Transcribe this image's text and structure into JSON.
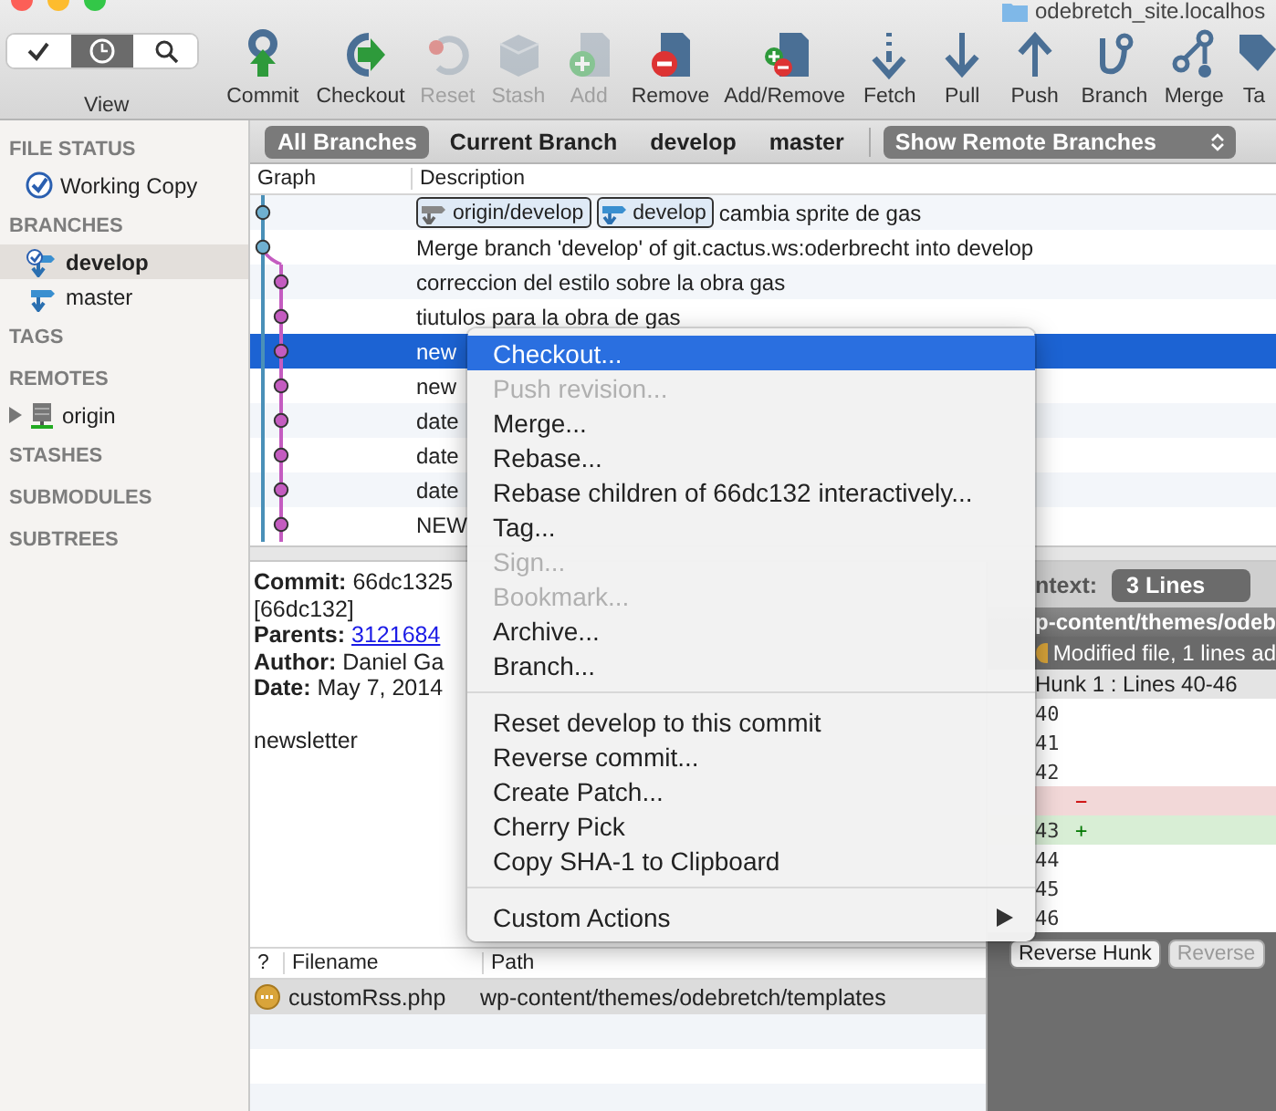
{
  "window": {
    "title": "odebretch_site.localhos"
  },
  "toolbar": {
    "view": {
      "label": "View",
      "segments": [
        {
          "selected": false
        },
        {
          "selected": true
        },
        {
          "selected": false
        }
      ]
    },
    "buttons": [
      {
        "label": "Commit",
        "disabled": false
      },
      {
        "label": "Checkout",
        "disabled": false
      },
      {
        "label": "Reset",
        "disabled": true
      },
      {
        "label": "Stash",
        "disabled": true
      },
      {
        "label": "Add",
        "disabled": true
      },
      {
        "label": "Remove",
        "disabled": false
      },
      {
        "label": "Add/Remove",
        "disabled": false
      },
      {
        "label": "Fetch",
        "disabled": false
      },
      {
        "label": "Pull",
        "disabled": false
      },
      {
        "label": "Push",
        "disabled": false
      },
      {
        "label": "Branch",
        "disabled": false
      },
      {
        "label": "Merge",
        "disabled": false
      },
      {
        "label": "Ta",
        "disabled": false
      }
    ]
  },
  "filter_bar": {
    "tabs": [
      {
        "label": "All Branches",
        "selected": true
      },
      {
        "label": "Current Branch",
        "selected": false
      },
      {
        "label": "develop",
        "selected": false
      },
      {
        "label": "master",
        "selected": false
      }
    ],
    "dropdown": "Show Remote Branches"
  },
  "sidebar": {
    "sections": [
      {
        "title": "FILE STATUS",
        "items": [
          {
            "label": "Working Copy",
            "kind": "status",
            "selected": false
          }
        ]
      },
      {
        "title": "BRANCHES",
        "items": [
          {
            "label": "develop",
            "kind": "branch",
            "selected": true,
            "current": true
          },
          {
            "label": "master",
            "kind": "branch",
            "selected": false,
            "current": false
          }
        ]
      },
      {
        "title": "TAGS"
      },
      {
        "title": "REMOTES",
        "items": [
          {
            "label": "origin",
            "kind": "remote",
            "selected": false,
            "expanded": false
          }
        ]
      },
      {
        "title": "STASHES"
      },
      {
        "title": "SUBMODULES"
      },
      {
        "title": "SUBTREES"
      }
    ]
  },
  "commit_list": {
    "columns": [
      "Graph",
      "Description"
    ],
    "rows": [
      {
        "description": "cambia sprite de gas",
        "selected": false,
        "refs": [
          {
            "name": "origin/develop",
            "kind": "remote"
          },
          {
            "name": "develop",
            "kind": "local"
          }
        ]
      },
      {
        "description": "Merge branch 'develop' of git.cactus.ws:oderbrecht into develop",
        "selected": false
      },
      {
        "description": "correccion del estilo sobre la obra gas",
        "selected": false
      },
      {
        "description": "tiutulos para la obra de gas",
        "selected": false
      },
      {
        "description": "new",
        "selected": true
      },
      {
        "description": "new",
        "selected": false
      },
      {
        "description": "date",
        "selected": false
      },
      {
        "description": "date",
        "selected": false
      },
      {
        "description": "date",
        "selected": false
      },
      {
        "description": "NEW",
        "selected": false
      }
    ]
  },
  "commit_details": {
    "fields": [
      {
        "label": "Commit:",
        "value": "66dc1325"
      },
      {
        "value": "[66dc132]"
      },
      {
        "label": "Parents:",
        "value": "3121684",
        "kind": "link"
      },
      {
        "label": "Author:",
        "value": "Daniel Ga"
      },
      {
        "label": "Date:",
        "value": "May 7, 2014"
      }
    ],
    "message": "newsletter"
  },
  "files": {
    "columns": [
      "?",
      "Filename",
      "Path"
    ],
    "rows": [
      {
        "filename": "customRss.php",
        "path": "wp-content/themes/odebretch/templates",
        "selected": true
      }
    ]
  },
  "diff": {
    "context_label": "ntext:",
    "context_value": "3 Lines",
    "file_path": "p-content/themes/odeb",
    "file_status": "Modified file, 1 lines ad",
    "hunk_title": "Hunk 1 : Lines 40-46",
    "lines": [
      {
        "number": "40",
        "kind": "context"
      },
      {
        "number": "41",
        "kind": "context"
      },
      {
        "number": "42",
        "kind": "context"
      },
      {
        "marker": "−",
        "kind": "removed"
      },
      {
        "number": "43",
        "marker": "+",
        "kind": "added"
      },
      {
        "number": "44",
        "kind": "context"
      },
      {
        "number": "45",
        "kind": "context"
      },
      {
        "number": "46",
        "kind": "context"
      }
    ],
    "buttons": [
      {
        "label": "Reverse Hunk",
        "disabled": false
      },
      {
        "label": "Reverse",
        "disabled": true
      }
    ]
  },
  "context_menu": {
    "groups": [
      [
        {
          "label": "Checkout...",
          "disabled": false,
          "selected": true
        },
        {
          "label": "Push revision...",
          "disabled": true,
          "selected": false
        },
        {
          "label": "Merge...",
          "disabled": false,
          "selected": false
        },
        {
          "label": "Rebase...",
          "disabled": false,
          "selected": false
        },
        {
          "label": "Rebase children of 66dc132 interactively...",
          "disabled": false,
          "selected": false
        },
        {
          "label": "Tag...",
          "disabled": false,
          "selected": false
        },
        {
          "label": "Sign...",
          "disabled": true,
          "selected": false
        },
        {
          "label": "Bookmark...",
          "disabled": true,
          "selected": false
        },
        {
          "label": "Archive...",
          "disabled": false,
          "selected": false
        },
        {
          "label": "Branch...",
          "disabled": false,
          "selected": false
        }
      ],
      [
        {
          "label": "Reset develop to this commit",
          "disabled": false,
          "selected": false
        },
        {
          "label": "Reverse commit...",
          "disabled": false,
          "selected": false
        },
        {
          "label": "Create Patch...",
          "disabled": false,
          "selected": false
        },
        {
          "label": "Cherry Pick",
          "disabled": false,
          "selected": false
        },
        {
          "label": "Copy SHA-1 to Clipboard",
          "disabled": false,
          "selected": false
        }
      ],
      [
        {
          "label": "Custom Actions",
          "disabled": false,
          "selected": false,
          "kind": "submenu"
        }
      ]
    ]
  }
}
